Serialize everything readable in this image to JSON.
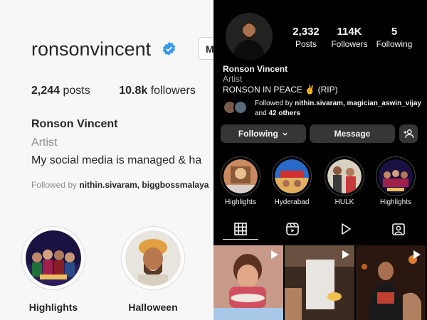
{
  "left_profile": {
    "username": "ronsonvincent",
    "button_partial": "M",
    "posts_count": "2,244",
    "posts_label": "posts",
    "followers_count": "10.8k",
    "followers_label": "followers",
    "name": "Ronson Vincent",
    "category": "Artist",
    "bio": "My social media is managed & ha",
    "followed_by_prefix": "Followed by",
    "followed_by_names": "nithin.sivaram, biggbossmalaya",
    "highlights": [
      {
        "label": "Highlights"
      },
      {
        "label": "Halloween"
      }
    ]
  },
  "right_profile": {
    "stats": [
      {
        "count": "2,332",
        "label": "Posts"
      },
      {
        "count": "114K",
        "label": "Followers"
      },
      {
        "count": "5",
        "label": "Following"
      }
    ],
    "name": "Ronson Vincent",
    "category": "Artist",
    "bio": "RONSON IN PEACE ✌️ (RIP)",
    "followed_by_prefix": "Followed by",
    "followed_by_names": "nithin.sivaram, magician_aswin_vijay",
    "followed_by_and": "and",
    "followed_by_others": "42 others",
    "following_button": "Following",
    "message_button": "Message",
    "highlights": [
      {
        "label": "Highlights"
      },
      {
        "label": "Hyderabad"
      },
      {
        "label": "HULK"
      },
      {
        "label": "Highlights"
      }
    ]
  },
  "icons": {
    "verified": "verified-badge-icon",
    "chevron": "chevron-down-icon",
    "add_person": "add-person-icon",
    "grid_tab": "grid-icon",
    "reels_tab": "reels-icon",
    "play_tab": "play-icon",
    "tagged_tab": "tagged-icon"
  },
  "colors": {
    "verified_blue": "#3897f0",
    "dark_bg": "#000000",
    "button_dark": "#363636",
    "muted_text": "#8e8e8e"
  }
}
